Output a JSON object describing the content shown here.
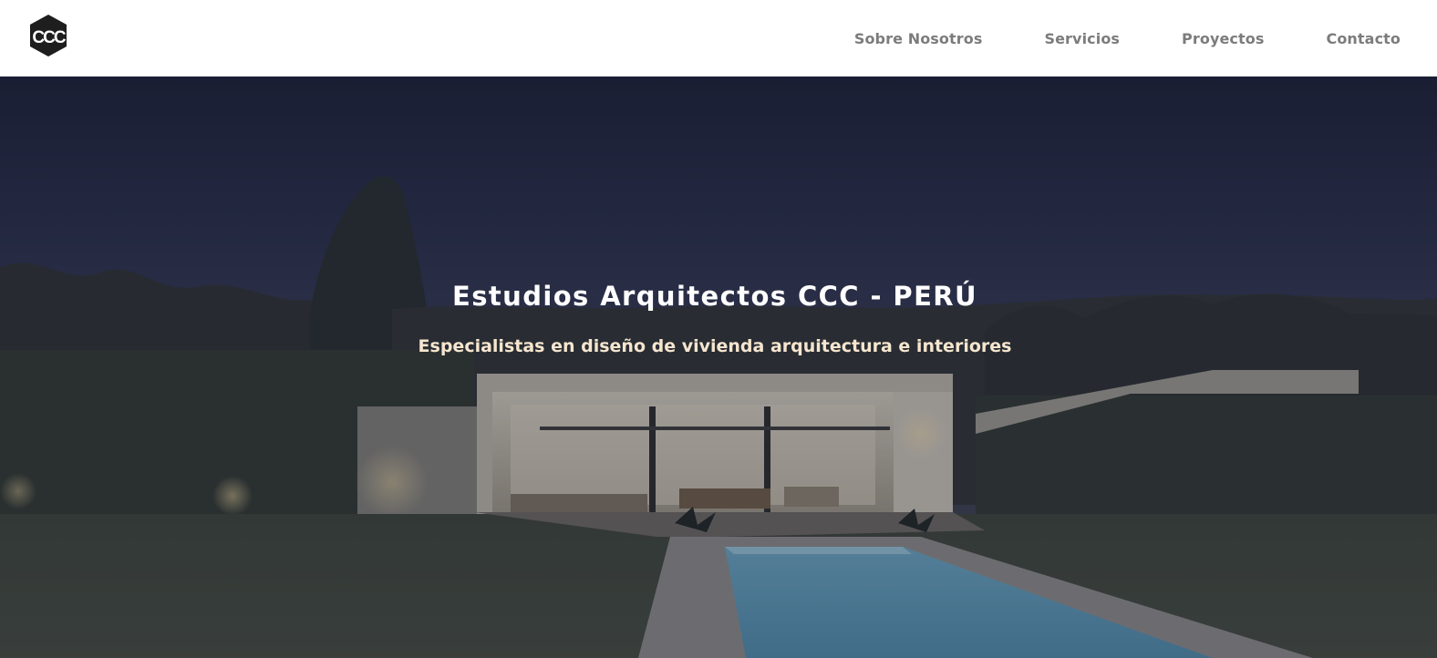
{
  "header": {
    "logo": {
      "text": "CCC",
      "icon": "ccc-hexagon-logo"
    },
    "nav": [
      {
        "label": "Sobre Nosotros"
      },
      {
        "label": "Servicios"
      },
      {
        "label": "Proyectos"
      },
      {
        "label": "Contacto"
      }
    ]
  },
  "hero": {
    "title": "Estudios Arquitectos CCC - PERÚ",
    "subtitle": "Especialistas en diseño de vivienda arquitectura e interiores",
    "background_image": "night-house-with-pool",
    "colors": {
      "title": "#ffffff",
      "subtitle": "#f6e6cf",
      "overlay": "#1c2037"
    }
  }
}
